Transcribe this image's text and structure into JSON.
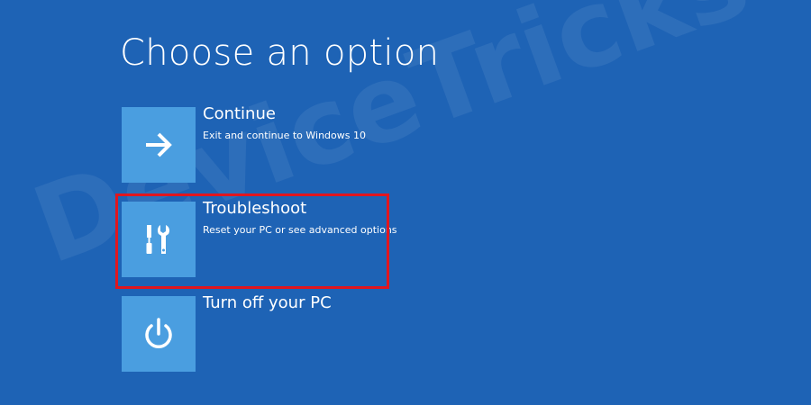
{
  "screen": {
    "title": "Choose an option",
    "accent_color": "#1e63b5",
    "tile_color": "#4a9ee0",
    "highlight_color": "#e1161e"
  },
  "options": [
    {
      "label": "Continue",
      "description": "Exit and continue to Windows 10",
      "icon": "arrow-right-icon"
    },
    {
      "label": "Troubleshoot",
      "description": "Reset your PC or see advanced options",
      "icon": "tools-icon"
    },
    {
      "label": "Turn off your PC",
      "description": "",
      "icon": "power-icon"
    }
  ],
  "watermark": {
    "text": "DeviceTricks"
  }
}
